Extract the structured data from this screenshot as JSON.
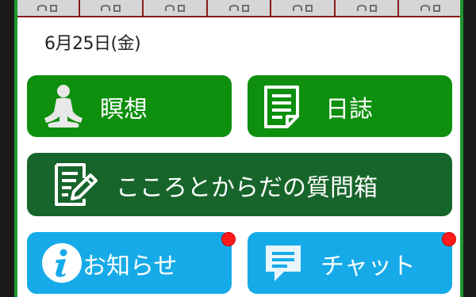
{
  "header": {
    "date": "6月25日(金)"
  },
  "week_strip": {
    "days": 7
  },
  "tiles": {
    "meditation": {
      "label": "瞑想",
      "icon": "meditation-icon",
      "color": "#0e8f0e"
    },
    "diary": {
      "label": "日誌",
      "icon": "document-icon",
      "color": "#0e8f0e"
    },
    "questions": {
      "label": "こころとからだの質問箱",
      "icon": "edit-document-icon",
      "color": "#18652b"
    },
    "news": {
      "label": "お知らせ",
      "icon": "info-icon",
      "color": "#16abe8",
      "has_notification": true
    },
    "chat": {
      "label": "チャット",
      "icon": "chat-icon",
      "color": "#16abe8",
      "has_notification": true
    }
  },
  "colors": {
    "frame_accent": "#1b9a2e",
    "notification": "#ff1a1a"
  }
}
